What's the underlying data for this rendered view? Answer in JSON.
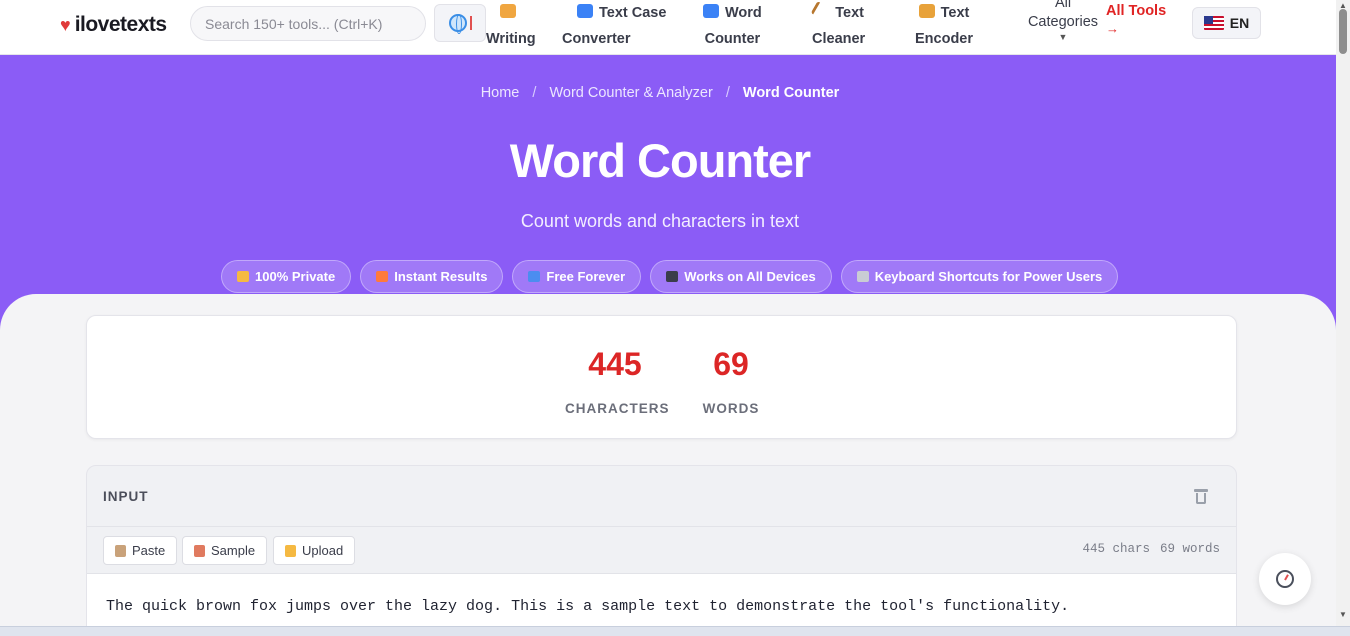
{
  "header": {
    "logo": "ilovetexts",
    "search_placeholder": "Search 150+ tools... (Ctrl+K)",
    "nav": [
      {
        "line1": "Writing",
        "line2": ""
      },
      {
        "line1": "Text Case",
        "line2": "Converter"
      },
      {
        "line1": "Word",
        "line2": "Counter"
      },
      {
        "line1": "Text",
        "line2": "Cleaner"
      },
      {
        "line1": "Text",
        "line2": "Encoder"
      }
    ],
    "all_categories_line1": "All",
    "all_categories_line2": "Categories",
    "all_tools": "All Tools",
    "all_tools_arrow": "→",
    "language": "EN"
  },
  "breadcrumb": {
    "home": "Home",
    "parent": "Word Counter & Analyzer",
    "current": "Word Counter",
    "separator": "/"
  },
  "hero": {
    "title": "Word Counter",
    "subtitle": "Count words and characters in text",
    "badges": [
      {
        "label": "100% Private",
        "color": "#f5b942"
      },
      {
        "label": "Instant Results",
        "color": "#ff7a3c"
      },
      {
        "label": "Free Forever",
        "color": "#4b8df0"
      },
      {
        "label": "Works on All Devices",
        "color": "#3a3d4a"
      },
      {
        "label": "Keyboard Shortcuts for Power Users",
        "color": "#c9ccd4"
      }
    ]
  },
  "stats": {
    "characters_value": "445",
    "characters_label": "CHARACTERS",
    "words_value": "69",
    "words_label": "WORDS"
  },
  "input": {
    "title": "INPUT",
    "paste_label": "Paste",
    "sample_label": "Sample",
    "upload_label": "Upload",
    "chars_count": "445 chars",
    "words_count": "69 words",
    "text": "The quick brown fox jumps over the lazy dog. This is a sample text to demonstrate the tool's functionality."
  },
  "colors": {
    "accent": "#8b5cf6",
    "stat_value": "#dc2626",
    "all_tools": "#e02424"
  }
}
